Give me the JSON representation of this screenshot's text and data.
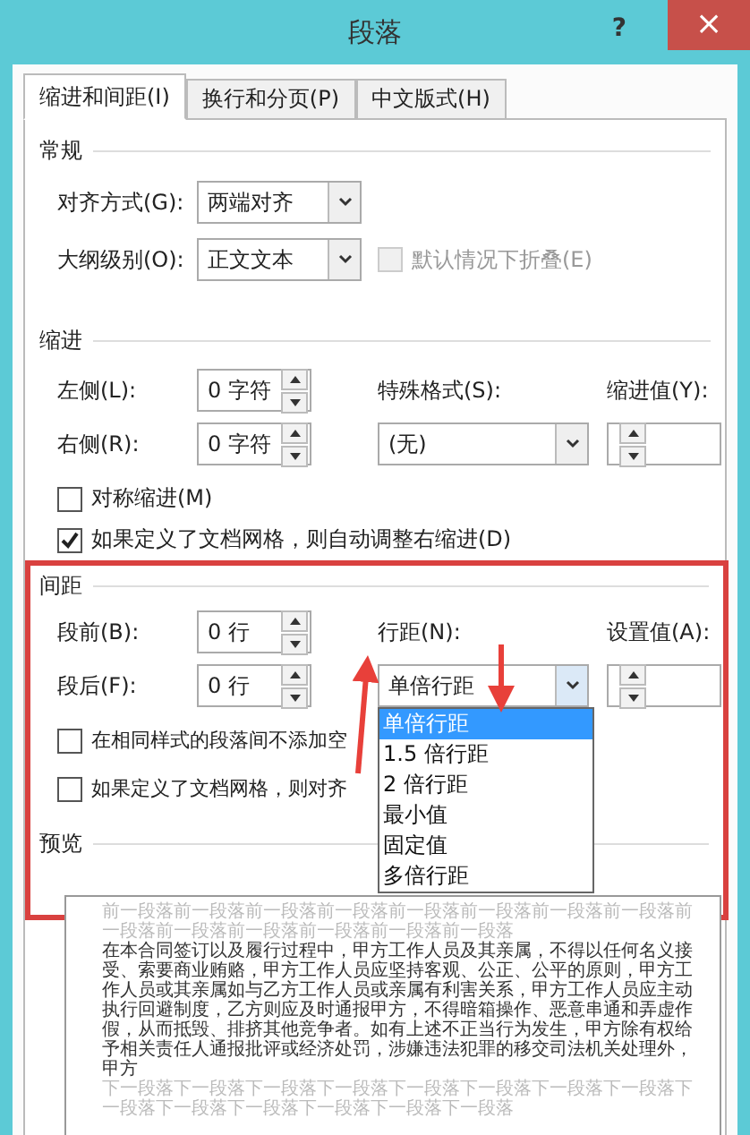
{
  "window": {
    "title": "段落",
    "help": "?",
    "close": "×"
  },
  "tabs": [
    {
      "label": "缩进和间距(I)",
      "selected": true
    },
    {
      "label": "换行和分页(P)",
      "selected": false
    },
    {
      "label": "中文版式(H)",
      "selected": false
    }
  ],
  "general": {
    "heading": "常规",
    "alignment": {
      "label": "对齐方式(G):",
      "value": "两端对齐"
    },
    "outline_level": {
      "label": "大纲级别(O):",
      "value": "正文文本"
    },
    "collapse": {
      "label": "默认情况下折叠(E)",
      "checked": false,
      "disabled": true
    }
  },
  "indent": {
    "heading": "缩进",
    "left": {
      "label": "左侧(L):",
      "value": "0 字符"
    },
    "right": {
      "label": "右侧(R):",
      "value": "0 字符"
    },
    "special": {
      "label": "特殊格式(S):",
      "value": "(无)",
      "expanded": false
    },
    "by": {
      "label": "缩进值(Y):"
    },
    "checkboxes": [
      {
        "label": "对称缩进(M)",
        "checked": false
      },
      {
        "label": "如果定义了文档网格，则自动调整右缩进(D)",
        "checked": true
      }
    ]
  },
  "spacing": {
    "heading": "间距",
    "highlighted": true,
    "before": {
      "label": "段前(B):",
      "value": "0 行"
    },
    "after": {
      "label": "段后(F):",
      "value": "0 行"
    },
    "line_spacing": {
      "label": "行距(N):",
      "value": "单倍行距",
      "expanded": true,
      "options": [
        {
          "label": "单倍行距",
          "selected": true
        },
        {
          "label": "1.5 倍行距",
          "selected": false
        },
        {
          "label": "2 倍行距",
          "selected": false
        },
        {
          "label": "最小值",
          "selected": false
        },
        {
          "label": "固定值",
          "selected": false
        },
        {
          "label": "多倍行距",
          "selected": false
        }
      ]
    },
    "at": {
      "label": "设置值(A):"
    },
    "checkboxes": [
      {
        "label": "在相同样式的段落间不添加空",
        "checked": false
      },
      {
        "label": "如果定义了文档网格，则对齐",
        "checked": false
      }
    ]
  },
  "preview": {
    "heading": "预览",
    "previous_text": "前一段落前一段落前一段落前一段落前一段落前一段落前一段落前一段落前一段落前一段落前一段落前一段落前一段落前一段落",
    "text": "在本合同签订以及履行过程中，甲方工作人员及其亲属，不得以任何名义接受、索要商业贿赂，甲方工作人员应坚持客观、公正、公平的原则，甲方工作人员或其亲属如与乙方工作人员或亲属有利害关系，甲方工作人员应主动执行回避制度，乙方则应及时通报甲方，不得暗箱操作、恶意串通和弄虚作假，从而抵毁、排挤其他竞争者。如有上述不正当行为发生，甲方除有权给予相关责任人通报批评或经济处罚，涉嫌违法犯罪的移交司法机关处理外，甲方",
    "next_text": "下一段落下一段落下一段落下一段落下一段落下一段落下一段落下一段落下一段落下一段落下一段落下一段落下一段落下一段落"
  }
}
